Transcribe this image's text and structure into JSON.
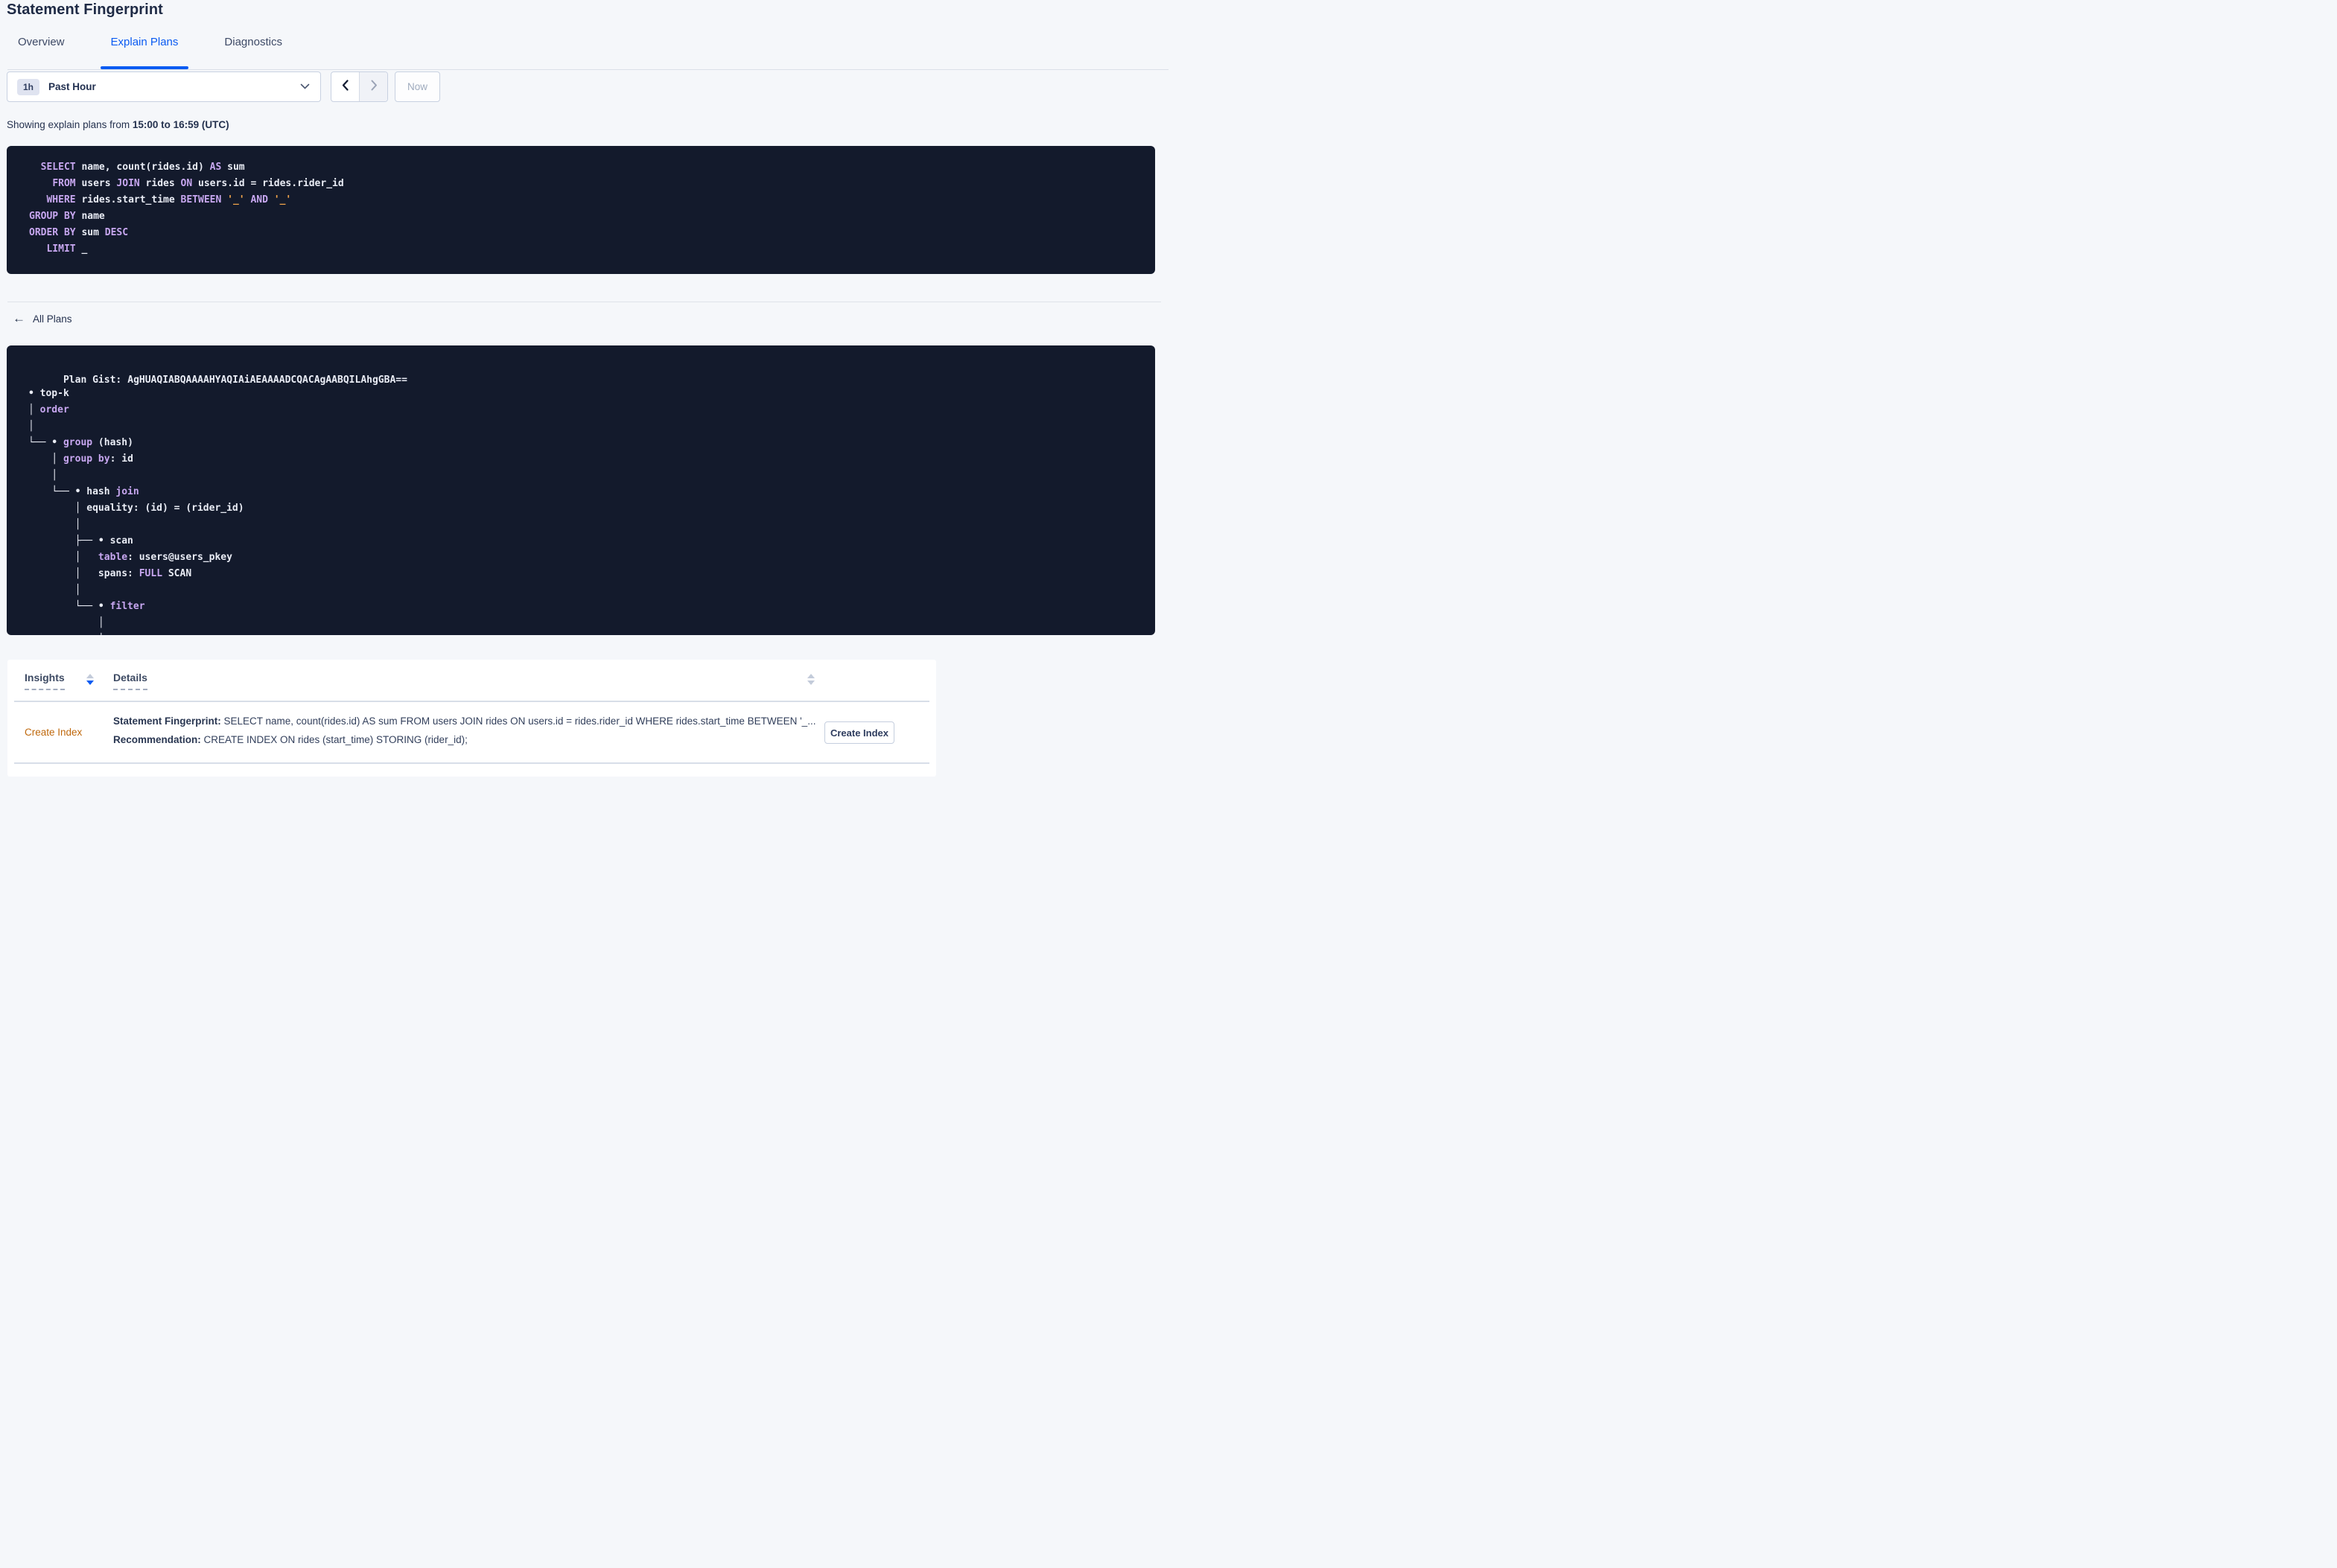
{
  "header": {
    "title": "Statement Fingerprint"
  },
  "tabs": {
    "overview": "Overview",
    "explain_plans": "Explain Plans",
    "diagnostics": "Diagnostics"
  },
  "time_picker": {
    "interval_badge": "1h",
    "selected": "Past Hour",
    "now_label": "Now"
  },
  "status_line": {
    "prefix": "Showing explain plans from ",
    "range_bold": "15:00 to 16:59 (UTC)"
  },
  "sql_statement": {
    "lines": [
      [
        {
          "t": "  "
        },
        {
          "t": "SELECT",
          "c": "kw"
        },
        {
          "t": " name, count(rides.id) "
        },
        {
          "t": "AS",
          "c": "kw"
        },
        {
          "t": " sum"
        }
      ],
      [
        {
          "t": "    "
        },
        {
          "t": "FROM",
          "c": "kw"
        },
        {
          "t": " users "
        },
        {
          "t": "JOIN",
          "c": "kw"
        },
        {
          "t": " rides "
        },
        {
          "t": "ON",
          "c": "kw"
        },
        {
          "t": " users.id = rides.rider_id"
        }
      ],
      [
        {
          "t": "   "
        },
        {
          "t": "WHERE",
          "c": "kw"
        },
        {
          "t": " rides.start_time "
        },
        {
          "t": "BETWEEN",
          "c": "kw"
        },
        {
          "t": " "
        },
        {
          "t": "'_'",
          "c": "lit"
        },
        {
          "t": " "
        },
        {
          "t": "AND",
          "c": "kw"
        },
        {
          "t": " "
        },
        {
          "t": "'_'",
          "c": "lit"
        }
      ],
      [
        {
          "t": "GROUP BY",
          "c": "kw"
        },
        {
          "t": " name"
        }
      ],
      [
        {
          "t": "ORDER BY",
          "c": "kw"
        },
        {
          "t": " sum "
        },
        {
          "t": "DESC",
          "c": "kw"
        }
      ],
      [
        {
          "t": "   "
        },
        {
          "t": "LIMIT",
          "c": "kw"
        },
        {
          "t": " _"
        }
      ]
    ]
  },
  "nav": {
    "back_arrow": "←",
    "back_label": "All Plans"
  },
  "plan_gist_block": {
    "gist_prefix": "Plan Gist:",
    "gist": "AgHUAQIABQAAAAHYAQIAiAEAAAADCQACAgAABQILAhgGBA==",
    "tree_lines": [
      [
        {
          "t": "• top-k"
        }
      ],
      [
        {
          "t": "│ "
        },
        {
          "t": "order",
          "c": "kw"
        }
      ],
      [
        {
          "t": "│"
        }
      ],
      [
        {
          "t": "└── • "
        },
        {
          "t": "group",
          "c": "kw"
        },
        {
          "t": " (hash)"
        }
      ],
      [
        {
          "t": "    │ "
        },
        {
          "t": "group by",
          "c": "kw"
        },
        {
          "t": ": id"
        }
      ],
      [
        {
          "t": "    │"
        }
      ],
      [
        {
          "t": "    └── • hash "
        },
        {
          "t": "join",
          "c": "kw"
        }
      ],
      [
        {
          "t": "        │ equality: (id) = (rider_id)"
        }
      ],
      [
        {
          "t": "        │"
        }
      ],
      [
        {
          "t": "        ├── • scan"
        }
      ],
      [
        {
          "t": "        │   "
        },
        {
          "t": "table",
          "c": "kw"
        },
        {
          "t": ": users@users_pkey"
        }
      ],
      [
        {
          "t": "        │   spans: "
        },
        {
          "t": "FULL",
          "c": "kw"
        },
        {
          "t": " SCAN"
        }
      ],
      [
        {
          "t": "        │"
        }
      ],
      [
        {
          "t": "        └── • "
        },
        {
          "t": "filter",
          "c": "kw"
        }
      ],
      [
        {
          "t": "            │"
        }
      ],
      [
        {
          "t": "            │"
        }
      ]
    ]
  },
  "insights_table": {
    "col_insights": "Insights",
    "col_details": "Details",
    "row": {
      "insight": "Create Index",
      "fingerprint_label": "Statement Fingerprint:",
      "fingerprint": " SELECT name, count(rides.id) AS sum FROM users JOIN rides ON users.id = rides.rider_id WHERE rides.start_time BETWEEN '_...",
      "recommendation_label": "Recommendation:",
      "recommendation": " CREATE INDEX ON rides (start_time) STORING (rider_id);",
      "action_label": "Create Index"
    }
  },
  "colors": {
    "accent_blue": "#0A5BF2",
    "keyword_purple": "#C7A7F0",
    "literal_orange": "#F2A44A",
    "insight_orange": "#BF680C",
    "code_background": "#131A2C"
  }
}
